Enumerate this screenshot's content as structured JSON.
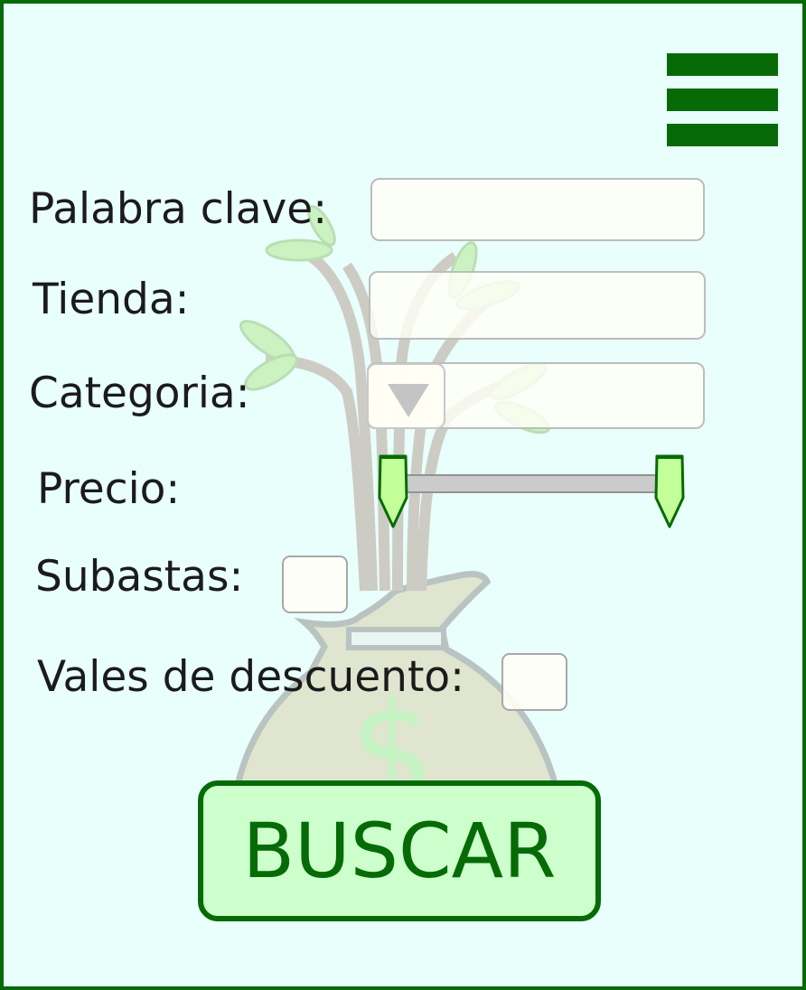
{
  "menu": {
    "icon": "hamburger-menu-icon"
  },
  "form": {
    "keyword_label": "Palabra clave:",
    "keyword_value": "",
    "store_label": "Tienda:",
    "store_value": "",
    "category_label": "Categoria:",
    "category_value": "",
    "category_dropdown_icon": "triangle-down-icon",
    "price_label": "Precio:",
    "price_range": {
      "min_fraction": 0.0,
      "max_fraction": 1.0
    },
    "auctions_label": "Subastas:",
    "auctions_checked": false,
    "coupons_label": "Vales de descuento:",
    "coupons_checked": false
  },
  "search_button_label": "BUSCAR",
  "background": {
    "illustration": "money-bag-tree-icon",
    "symbol": "dollar-sign-icon"
  },
  "colors": {
    "accent": "#066b06",
    "background": "#e9fffb",
    "button_fill": "#ccffcc",
    "slider_thumb": "#c3ff98"
  }
}
